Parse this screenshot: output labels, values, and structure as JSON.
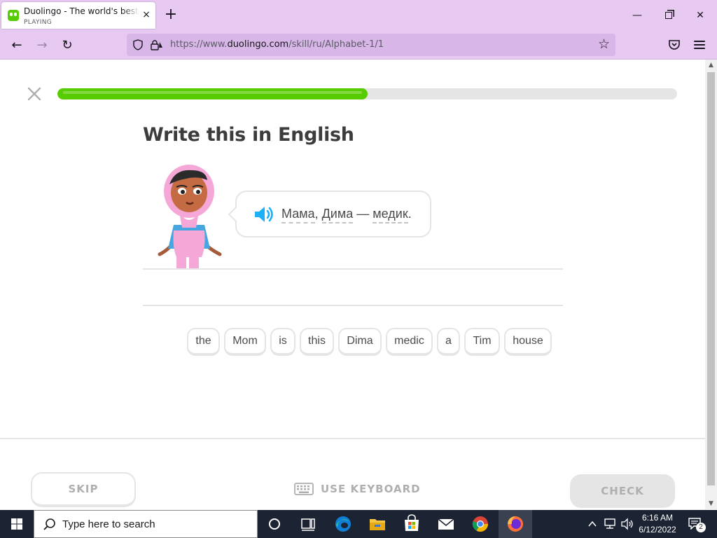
{
  "browser": {
    "tab": {
      "title": "Duolingo - The world's best way to learn a language",
      "status": "PLAYING",
      "close_glyph": "×"
    },
    "newtab_glyph": "+",
    "window": {
      "minimize_glyph": "—",
      "close_glyph": "✕"
    },
    "nav": {
      "back_glyph": "←",
      "forward_glyph": "→",
      "reload_glyph": "↻"
    },
    "url": {
      "prefix": "https://www.",
      "domain": "duolingo.com",
      "path": "/skill/ru/Alphabet-1/1"
    },
    "bookmark_glyph": "☆"
  },
  "lesson": {
    "quit_icon": "close-icon",
    "progress_fraction": 0.5,
    "heading": "Write this in English",
    "prompt": {
      "tokens": [
        {
          "text": "Мама",
          "hint": true
        },
        {
          "text": ", ",
          "hint": false
        },
        {
          "text": "Дима",
          "hint": true
        },
        {
          "text": " — ",
          "hint": false
        },
        {
          "text": "медик",
          "hint": true
        },
        {
          "text": ".",
          "hint": false
        }
      ]
    },
    "word_bank": [
      "the",
      "Mom",
      "is",
      "this",
      "Dima",
      "medic",
      "a",
      "Tim",
      "house"
    ]
  },
  "footer": {
    "skip_label": "SKIP",
    "use_keyboard_label": "USE KEYBOARD",
    "check_label": "CHECK"
  },
  "taskbar": {
    "search_placeholder": "Type here to search",
    "time": "6:16 AM",
    "date": "6/12/2022",
    "notification_count": "2"
  },
  "colors": {
    "progress_fill": "#58cc02",
    "chrome_bg": "#e7c9f2",
    "taskbar_bg": "#1c2333",
    "check_disabled_bg": "#e5e5e5"
  }
}
